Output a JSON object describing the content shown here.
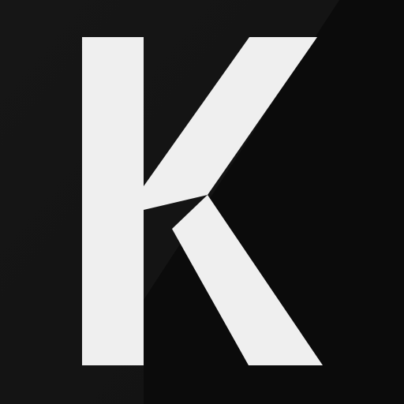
{
  "icon": {
    "name": "k-letter-logo",
    "letter": "K",
    "letter_color": "#efefef",
    "background_color": "#0b0b0b",
    "shade_color_dark": "#0a0a0a",
    "shade_color_light": "#151515"
  }
}
